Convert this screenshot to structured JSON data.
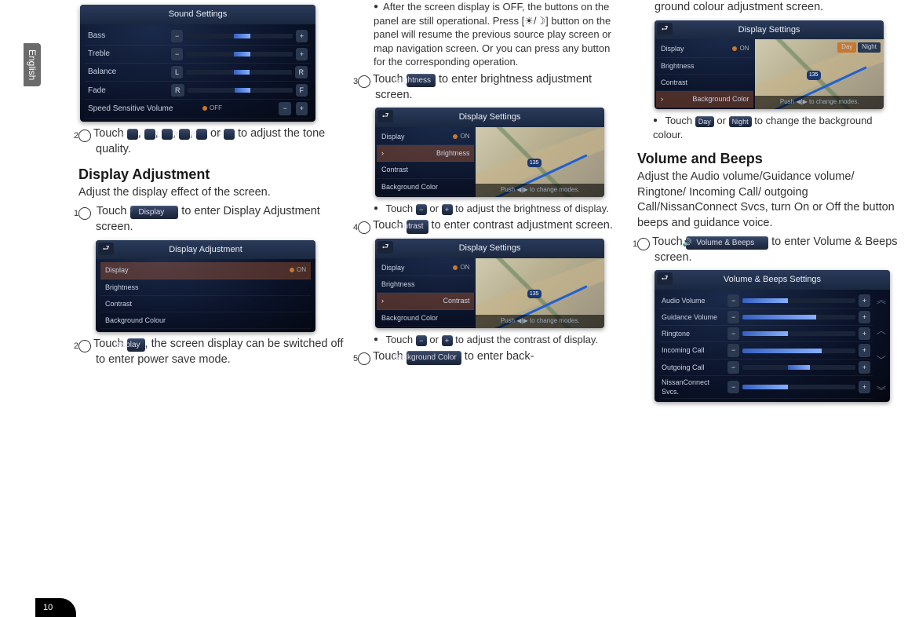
{
  "sideTab": "English",
  "pageNumber": "10",
  "col1": {
    "soundSettings": {
      "title": "Sound Settings",
      "rows": {
        "bass": "Bass",
        "treble": "Treble",
        "balance": "Balance",
        "fade": "Fade",
        "ssv": "Speed Sensitive Volume",
        "off": "OFF"
      },
      "btn": {
        "minus": "−",
        "plus": "+",
        "L": "L",
        "R": "R",
        "F": "F"
      }
    },
    "step2": {
      "prefix": "Touch ",
      "mid1": ", ",
      "mid2": ", ",
      "mid3": ", ",
      "mid4": ", ",
      "or": " or ",
      "suffix": " to adjust the tone quality."
    },
    "dispAdj": {
      "heading": "Display Adjustment",
      "intro": "Adjust the display effect of the screen.",
      "step1a": "Touch ",
      "step1b": " to enter Display Adjustment screen.",
      "displayBtn": "Display",
      "screen": {
        "title": "Display Adjustment",
        "display": "Display",
        "on": "ON",
        "brightness": "Brightness",
        "contrast": "Contrast",
        "bgColour": "Background Colour"
      },
      "step2a": "Touch ",
      "step2b": ", the screen display can be switched off to enter power save mode.",
      "dispBtn": "Display"
    }
  },
  "col2": {
    "note1": "After the screen display is OFF, the buttons on the panel are still operational. Press [☀/☽] button on the panel will resume the previous source play screen or map navigation screen. Or you can press any button for the corresponding operation.",
    "step3a": "Touch ",
    "step3b": " to enter brightness adjustment screen.",
    "brightnessBtn": "Brightness",
    "screen3": {
      "title": "Display Settings",
      "display": "Display",
      "on": "ON",
      "brightness": "Brightness",
      "contrast": "Contrast",
      "bgColor": "Background Color",
      "hint": "Push ◀|▶ to change modes."
    },
    "sub3": "Touch  − or +  to adjust the brightness of display.",
    "sub3a": "Touch ",
    "sub3or": " or ",
    "sub3b": " to adjust the brightness of display.",
    "step4a": "Touch ",
    "step4b": " to enter contrast adjustment screen.",
    "contrastBtn": "Contrast",
    "screen4": {
      "title": "Display Settings",
      "display": "Display",
      "on": "ON",
      "brightness": "Brightness",
      "contrast": "Contrast",
      "bgColor": "Background Color",
      "hint": "Push ◀|▶ to change modes."
    },
    "sub4a": "Touch ",
    "sub4or": " or ",
    "sub4b": " to adjust the contrast of display.",
    "step5a": "Touch ",
    "step5b": " to enter back-",
    "bgBtn": "Background Color"
  },
  "col3": {
    "cont": "ground colour adjustment screen.",
    "screen5": {
      "title": "Display Settings",
      "display": "Display",
      "on": "ON",
      "brightness": "Brightness",
      "contrast": "Contrast",
      "bgColor": "Background Color",
      "day": "Day",
      "night": "Night",
      "hint": "Push ◀|▶ to change modes.",
      "route": "135"
    },
    "sub5a": "Touch ",
    "sub5or": " or ",
    "sub5b": " to change the background colour.",
    "dayBtn": "Day",
    "nightBtn": "Night",
    "vb": {
      "heading": "Volume and Beeps",
      "intro": "Adjust the Audio volume/Guidance volume/ Ringtone/ Incoming Call/ outgoing Call/NissanConnect Svcs, turn On or Off the button beeps and guidance voice.",
      "step1a": "Touch ",
      "step1b": " to enter Volume & Beeps  screen.",
      "vbBtn": "Volume & Beeps",
      "screen": {
        "title": "Volume & Beeps Settings",
        "audio": "Audio Volume",
        "guidance": "Guidance Volume",
        "ringtone": "Ringtone",
        "incoming": "Incoming Call",
        "outgoing": "Outgoing Call",
        "ncs": "NissanConnect Svcs.",
        "minus": "−",
        "plus": "+"
      }
    }
  }
}
